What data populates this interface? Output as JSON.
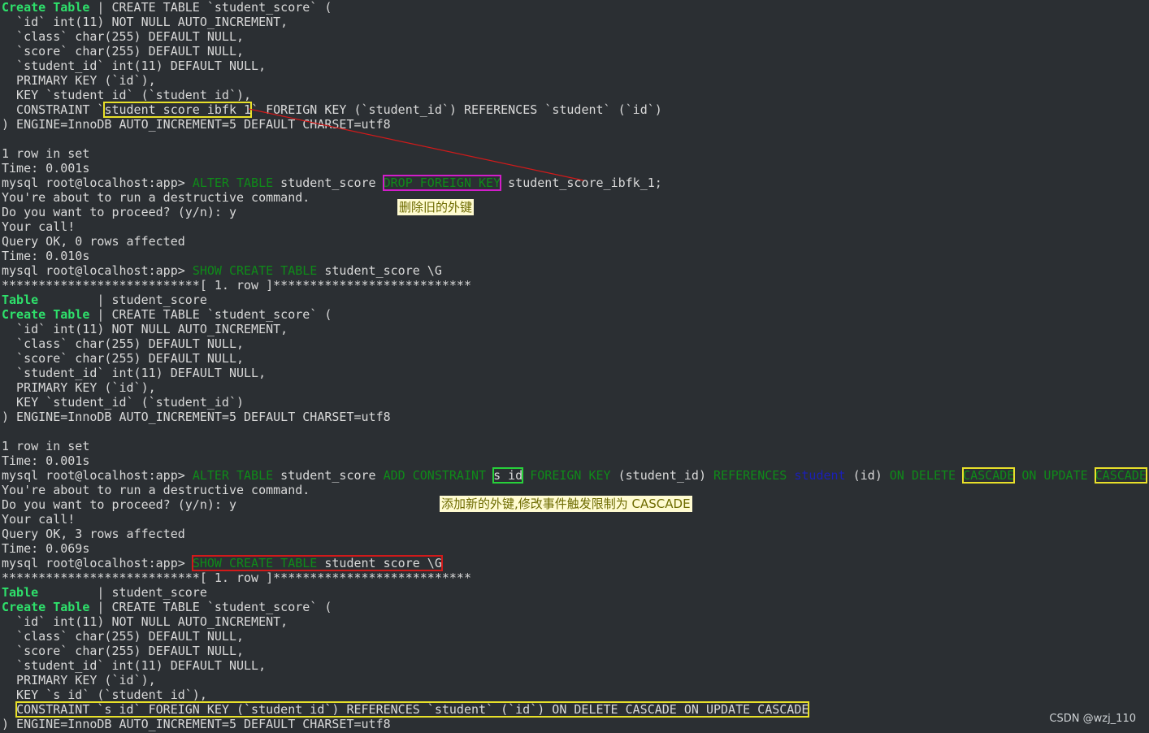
{
  "lines": [
    {
      "segs": [
        {
          "t": "Create Table",
          "c": "kw-g"
        },
        {
          "t": " | CREATE TABLE `student_score` ("
        }
      ]
    },
    {
      "segs": [
        {
          "t": "  `id` int(11) NOT NULL AUTO_INCREMENT,"
        }
      ]
    },
    {
      "segs": [
        {
          "t": "  `class` char(255) DEFAULT NULL,"
        }
      ]
    },
    {
      "segs": [
        {
          "t": "  `score` char(255) DEFAULT NULL,"
        }
      ]
    },
    {
      "segs": [
        {
          "t": "  `student_id` int(11) DEFAULT NULL,"
        }
      ]
    },
    {
      "segs": [
        {
          "t": "  PRIMARY KEY (`id`),"
        }
      ]
    },
    {
      "segs": [
        {
          "t": "  KEY `student_id` (`student_id`),"
        }
      ]
    },
    {
      "segs": [
        {
          "t": "  CONSTRAINT `"
        },
        {
          "t": "student_score_ibfk_1",
          "c": "box-yellow"
        },
        {
          "t": "` FOREIGN KEY (`student_id`) REFERENCES `student` (`id`)"
        }
      ]
    },
    {
      "segs": [
        {
          "t": ") ENGINE=InnoDB AUTO_INCREMENT=5 DEFAULT CHARSET=utf8"
        }
      ]
    },
    {
      "segs": [
        {
          "t": ""
        }
      ]
    },
    {
      "segs": [
        {
          "t": "1 row in set"
        }
      ]
    },
    {
      "segs": [
        {
          "t": "Time: 0.001s"
        }
      ]
    },
    {
      "segs": [
        {
          "t": "mysql root@localhost:app> "
        },
        {
          "t": "ALTER TABLE",
          "c": "kw-sql"
        },
        {
          "t": " student_score "
        },
        {
          "t": "DROP FOREIGN KEY",
          "c": "kw-sql box-magenta"
        },
        {
          "t": " student_score_ibfk_1;"
        }
      ]
    },
    {
      "segs": [
        {
          "t": "You're about to run a destructive command."
        }
      ]
    },
    {
      "segs": [
        {
          "t": "Do you want to proceed? (y/n): y"
        }
      ]
    },
    {
      "segs": [
        {
          "t": "Your call!"
        }
      ]
    },
    {
      "segs": [
        {
          "t": "Query OK, 0 rows affected"
        }
      ]
    },
    {
      "segs": [
        {
          "t": "Time: 0.010s"
        }
      ]
    },
    {
      "segs": [
        {
          "t": "mysql root@localhost:app> "
        },
        {
          "t": "SHOW CREATE TABLE",
          "c": "kw-sql"
        },
        {
          "t": " student_score \\G"
        }
      ]
    },
    {
      "segs": [
        {
          "t": "***************************[ 1. row ]***************************"
        }
      ]
    },
    {
      "segs": [
        {
          "t": "Table",
          "c": "kw-g"
        },
        {
          "t": "        | student_score"
        }
      ]
    },
    {
      "segs": [
        {
          "t": "Create Table",
          "c": "kw-g"
        },
        {
          "t": " | CREATE TABLE `student_score` ("
        }
      ]
    },
    {
      "segs": [
        {
          "t": "  `id` int(11) NOT NULL AUTO_INCREMENT,"
        }
      ]
    },
    {
      "segs": [
        {
          "t": "  `class` char(255) DEFAULT NULL,"
        }
      ]
    },
    {
      "segs": [
        {
          "t": "  `score` char(255) DEFAULT NULL,"
        }
      ]
    },
    {
      "segs": [
        {
          "t": "  `student_id` int(11) DEFAULT NULL,"
        }
      ]
    },
    {
      "segs": [
        {
          "t": "  PRIMARY KEY (`id`),"
        }
      ]
    },
    {
      "segs": [
        {
          "t": "  KEY `student_id` (`student_id`)"
        }
      ]
    },
    {
      "segs": [
        {
          "t": ") ENGINE=InnoDB AUTO_INCREMENT=5 DEFAULT CHARSET=utf8"
        }
      ]
    },
    {
      "segs": [
        {
          "t": ""
        }
      ]
    },
    {
      "segs": [
        {
          "t": "1 row in set"
        }
      ]
    },
    {
      "segs": [
        {
          "t": "Time: 0.001s"
        }
      ]
    },
    {
      "segs": [
        {
          "t": "mysql root@localhost:app> "
        },
        {
          "t": "ALTER TABLE",
          "c": "kw-sql"
        },
        {
          "t": " student_score "
        },
        {
          "t": "ADD CONSTRAINT",
          "c": "kw-sql"
        },
        {
          "t": " "
        },
        {
          "t": "s_id",
          "c": "box-green"
        },
        {
          "t": " "
        },
        {
          "t": "FOREIGN KEY",
          "c": "kw-sql"
        },
        {
          "t": " (student_id) "
        },
        {
          "t": "REFERENCES",
          "c": "kw-sql"
        },
        {
          "t": " "
        },
        {
          "t": "student",
          "c": "kw-blue"
        },
        {
          "t": " (id) "
        },
        {
          "t": "ON DELETE",
          "c": "kw-sql"
        },
        {
          "t": " "
        },
        {
          "t": "CASCADE",
          "c": "kw-sql box-yellow"
        },
        {
          "t": " "
        },
        {
          "t": "ON UPDATE",
          "c": "kw-sql"
        },
        {
          "t": " "
        },
        {
          "t": "CASCADE",
          "c": "kw-sql box-yellow"
        },
        {
          "t": ";"
        }
      ]
    },
    {
      "segs": [
        {
          "t": "You're about to run a destructive command."
        }
      ]
    },
    {
      "segs": [
        {
          "t": "Do you want to proceed? (y/n): y"
        }
      ]
    },
    {
      "segs": [
        {
          "t": "Your call!"
        }
      ]
    },
    {
      "segs": [
        {
          "t": "Query OK, 3 rows affected"
        }
      ]
    },
    {
      "segs": [
        {
          "t": "Time: 0.069s"
        }
      ]
    },
    {
      "segs": [
        {
          "t": "mysql root@localhost:app> "
        },
        {
          "t": "SHOW CREATE TABLE student_score \\G",
          "c": "box-red",
          "sub": [
            {
              "t": "SHOW CREATE TABLE",
              "c": "kw-sql"
            },
            {
              "t": " student_score \\G"
            }
          ]
        }
      ]
    },
    {
      "segs": [
        {
          "t": "***************************[ 1. row ]***************************"
        }
      ]
    },
    {
      "segs": [
        {
          "t": "Table",
          "c": "kw-g"
        },
        {
          "t": "        | student_score"
        }
      ]
    },
    {
      "segs": [
        {
          "t": "Create Table",
          "c": "kw-g"
        },
        {
          "t": " | CREATE TABLE `student_score` ("
        }
      ]
    },
    {
      "segs": [
        {
          "t": "  `id` int(11) NOT NULL AUTO_INCREMENT,"
        }
      ]
    },
    {
      "segs": [
        {
          "t": "  `class` char(255) DEFAULT NULL,"
        }
      ]
    },
    {
      "segs": [
        {
          "t": "  `score` char(255) DEFAULT NULL,"
        }
      ]
    },
    {
      "segs": [
        {
          "t": "  `student_id` int(11) DEFAULT NULL,"
        }
      ]
    },
    {
      "segs": [
        {
          "t": "  PRIMARY KEY (`id`),"
        }
      ]
    },
    {
      "segs": [
        {
          "t": "  KEY `s_id` (`student_id`),"
        }
      ]
    },
    {
      "segs": [
        {
          "t": "  "
        },
        {
          "t": "CONSTRAINT `s_id` FOREIGN KEY (`student_id`) REFERENCES `student` (`id`) ON DELETE CASCADE ON UPDATE CASCADE",
          "c": "box-yellow"
        }
      ]
    },
    {
      "segs": [
        {
          "t": ") ENGINE=InnoDB AUTO_INCREMENT=5 DEFAULT CHARSET=utf8"
        }
      ]
    }
  ],
  "annotations": {
    "drop_fk_note": "删除旧的外键",
    "add_fk_note": "添加新的外键,修改事件触发限制为 CASCADE"
  },
  "watermark": "CSDN @wzj_110",
  "colors": {
    "background": "#2b2f33",
    "text": "#d9d9d9",
    "keyword_bright": "#2ee06b",
    "keyword_sql": "#0f8a19",
    "arrow": "#d11a1a"
  }
}
